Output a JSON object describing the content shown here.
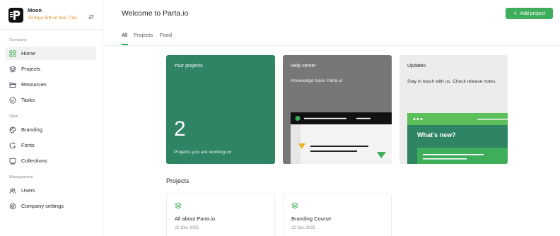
{
  "org": {
    "name": "Moon",
    "trial_text": "29 days left on free Trial",
    "logo_icon": "p-logo-icon",
    "switch_icon": "swap-icon"
  },
  "sidebar": {
    "sections": [
      {
        "label": "Company",
        "items": [
          {
            "label": "Home",
            "icon": "home-grid-icon",
            "active": true
          },
          {
            "label": "Projects",
            "icon": "layers-icon"
          },
          {
            "label": "Resources",
            "icon": "folder-icon"
          },
          {
            "label": "Tasks",
            "icon": "check-circle-icon"
          }
        ]
      },
      {
        "label": "Style",
        "items": [
          {
            "label": "Branding",
            "icon": "palette-icon"
          },
          {
            "label": "Fonts",
            "icon": "font-icon"
          },
          {
            "label": "Collections",
            "icon": "collection-icon"
          }
        ]
      },
      {
        "label": "Management",
        "items": [
          {
            "label": "Users",
            "icon": "users-icon"
          },
          {
            "label": "Company settings",
            "icon": "gear-icon"
          }
        ]
      }
    ]
  },
  "header": {
    "title": "Welcome to Parta.io",
    "add_button": "Add project"
  },
  "tabs": [
    {
      "label": "All",
      "active": true
    },
    {
      "label": "Projects"
    },
    {
      "label": "Feed"
    }
  ],
  "cards": {
    "projects": {
      "title": "Your projects",
      "count": "2",
      "subtitle": "Projects you are working on"
    },
    "help": {
      "title": "Help center",
      "subtitle": "Knowledge base Parta.io"
    },
    "updates": {
      "title": "Updates",
      "description": "Stay in touch with us. Check release notes.",
      "banner_title": "What's new?"
    }
  },
  "projects_section": {
    "title": "Projects",
    "items": [
      {
        "title": "All about Parta.io",
        "date": "22 Dec 2025",
        "icon": "layers-icon"
      },
      {
        "title": "Branding Course",
        "date": "22 Dec 2025",
        "icon": "layers-icon"
      }
    ]
  },
  "colors": {
    "accent": "#3fae5a",
    "projects_card": "#2f8464",
    "help_card": "#777777",
    "updates_card": "#ececec",
    "trial": "#e8922a"
  }
}
